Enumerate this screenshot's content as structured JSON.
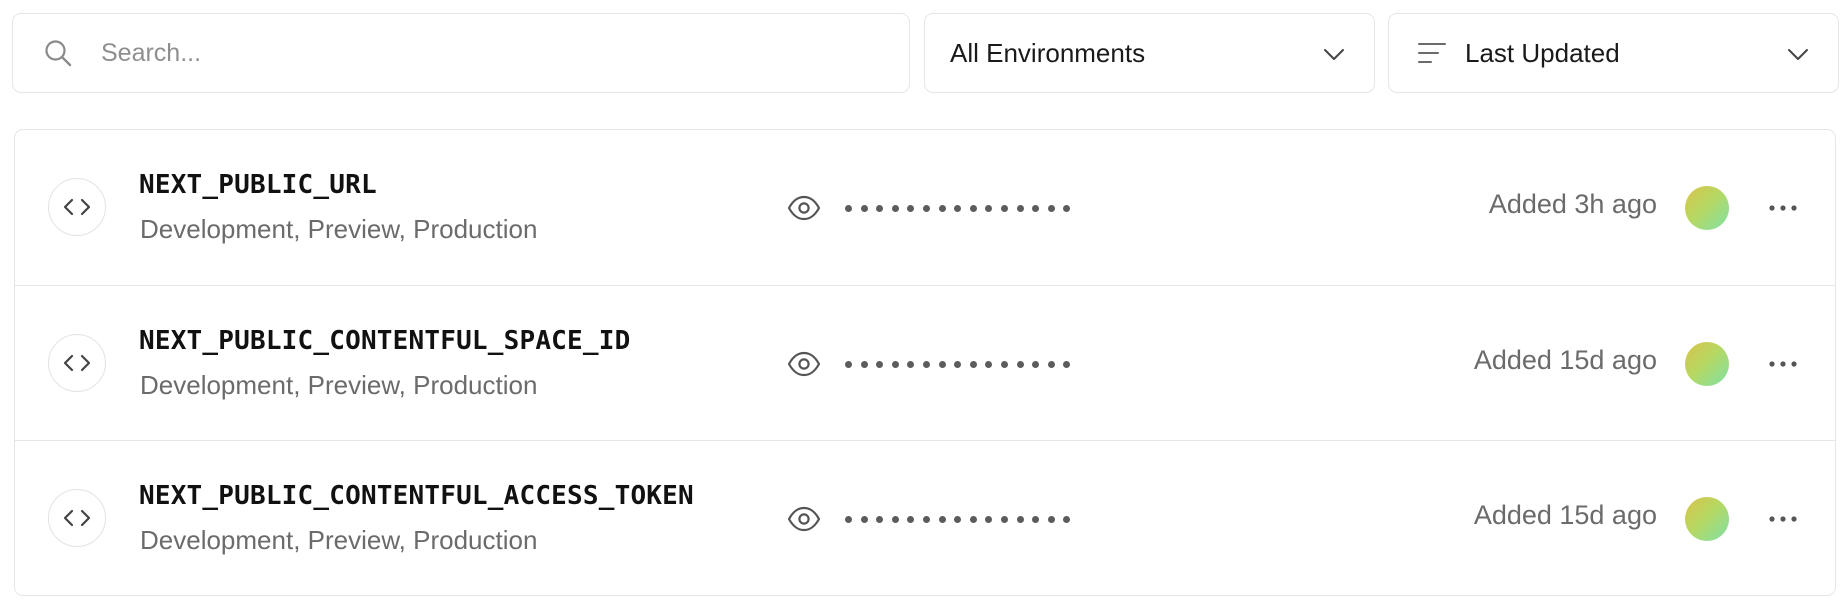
{
  "search": {
    "placeholder": "Search..."
  },
  "environment_filter": {
    "selected": "All Environments"
  },
  "sort": {
    "selected": "Last Updated"
  },
  "variables": [
    {
      "name": "NEXT_PUBLIC_URL",
      "environments": "Development, Preview, Production",
      "value_masked": "•••••••••••••••",
      "added": "Added 3h ago"
    },
    {
      "name": "NEXT_PUBLIC_CONTENTFUL_SPACE_ID",
      "environments": "Development, Preview, Production",
      "value_masked": "•••••••••••••••",
      "added": "Added 15d ago"
    },
    {
      "name": "NEXT_PUBLIC_CONTENTFUL_ACCESS_TOKEN",
      "environments": "Development, Preview, Production",
      "value_masked": "•••••••••••••••",
      "added": "Added 15d ago"
    }
  ],
  "icons": {
    "search": "search-icon",
    "chevron": "chevron-down-icon",
    "sort": "sort-lines-icon",
    "code": "code-brackets-icon",
    "eye": "eye-icon",
    "more": "more-horizontal-icon"
  },
  "colors": {
    "border": "#e6e6e6",
    "text_primary": "#111111",
    "text_secondary": "#6b6b6b",
    "avatar_gradient": [
      "#d9c24b",
      "#7fe0a6"
    ]
  }
}
